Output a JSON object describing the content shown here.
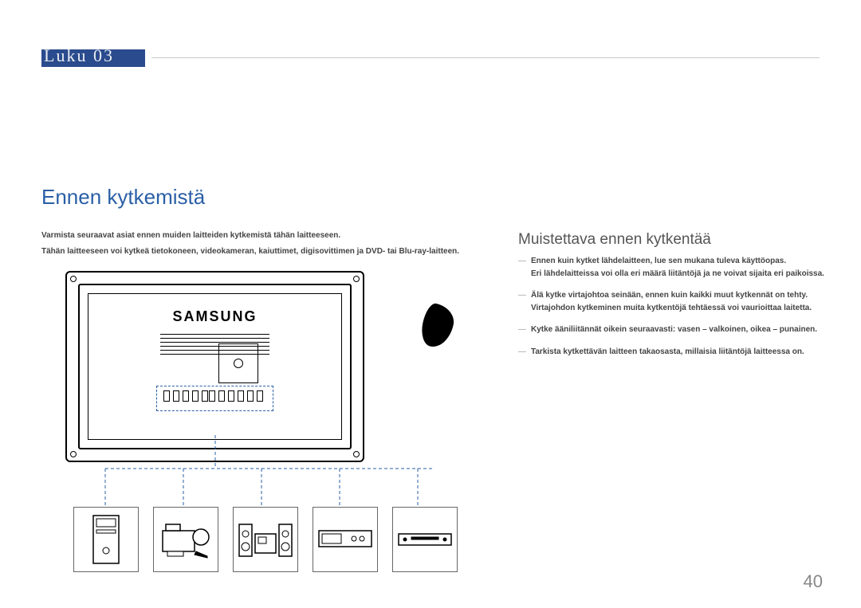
{
  "chapter": {
    "label": "Luku  03"
  },
  "section_heading": "Ennen kytkemistä",
  "intro": {
    "p1": "Varmista seuraavat asiat ennen muiden laitteiden kytkemistä tähän laitteeseen.",
    "p2": "Tähän laitteeseen voi kytkeä tietokoneen, videokameran, kaiuttimet, digisovittimen ja DVD- tai Blu-ray-laitteen."
  },
  "subheading": "Muistettava ennen kytkentää",
  "notes": {
    "n1a": "Ennen kuin kytket lähdelaitteen, lue sen mukana tuleva käyttöopas.",
    "n1b": "Eri lähdelaitteissa voi olla eri määrä liitäntöjä ja ne voivat sijaita eri paikoissa.",
    "n2a": "Älä kytke virtajohtoa seinään, ennen kuin kaikki muut kytkennät on tehty.",
    "n2b": "Virtajohdon kytkeminen muita kytkentöjä tehtäessä voi vaurioittaa laitetta.",
    "n3": "Kytke ääniliitännät oikein seuraavasti: vasen – valkoinen, oikea – punainen.",
    "n4": "Tarkista kytkettävän laitteen takaosasta, millaisia liitäntöjä laitteessa on."
  },
  "brand": "SAMSUNG",
  "page_number": "40",
  "devices": [
    "pc-tower",
    "camcorder",
    "stereo-speakers",
    "set-top-box",
    "dvd-player"
  ]
}
